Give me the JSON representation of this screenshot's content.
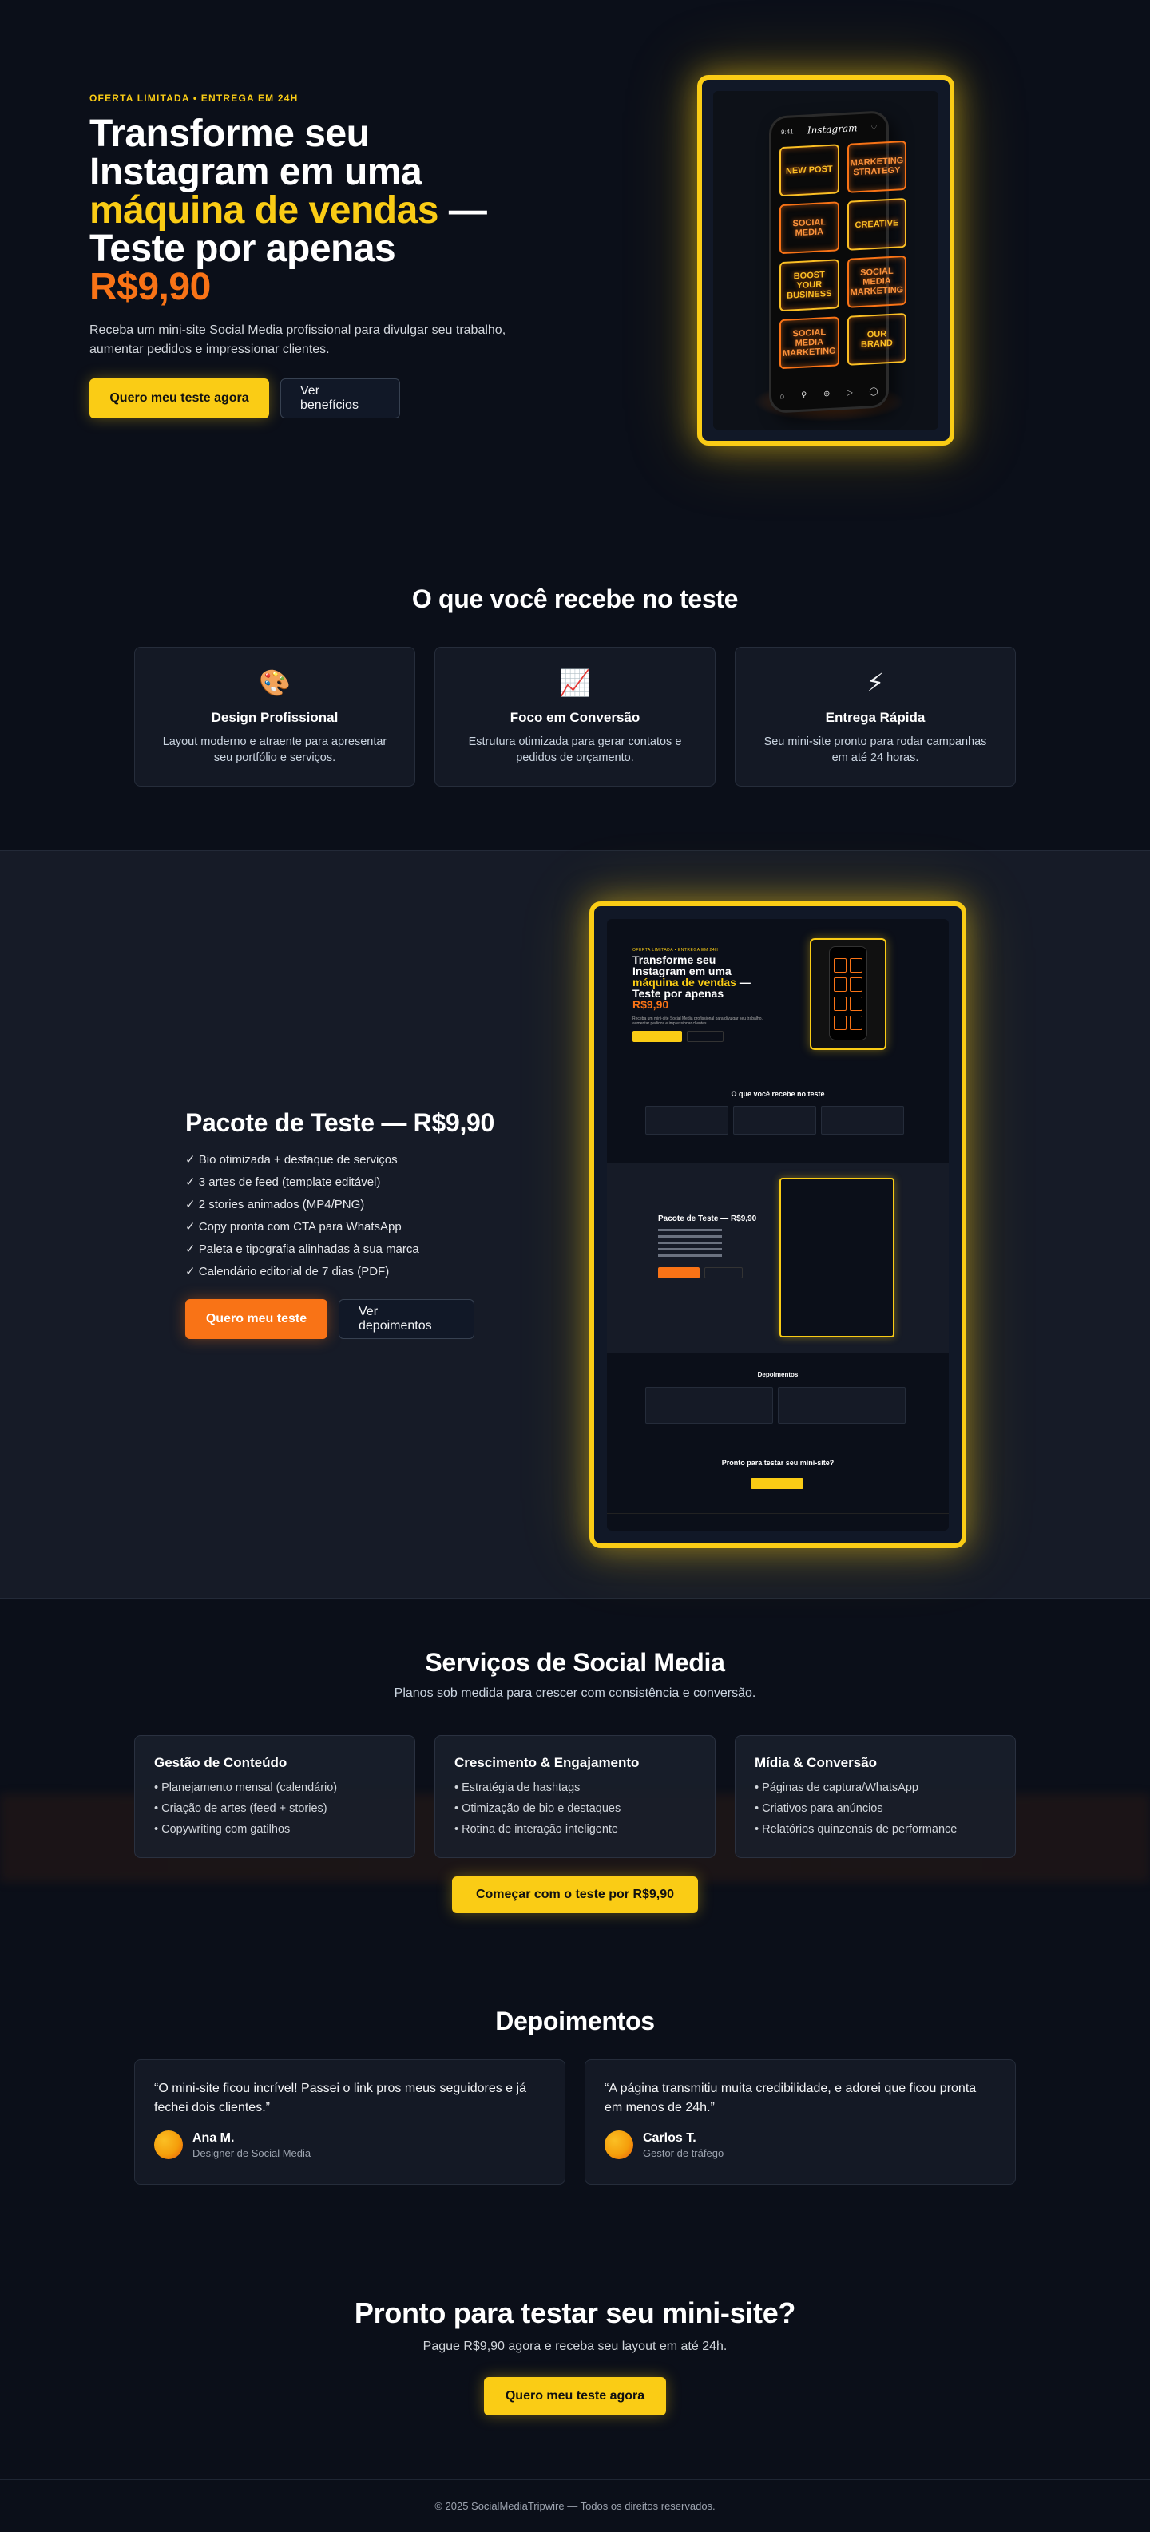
{
  "hero": {
    "eyebrow": "OFERTA LIMITADA • ENTREGA EM 24H",
    "title_line1": "Transforme seu",
    "title_line2": "Instagram em uma",
    "title_highlight": "máquina de vendas",
    "title_dash": " —",
    "title_line4": "Teste por apenas",
    "price": "R$9,90",
    "description": "Receba um mini-site Social Media profissional para divulgar seu trabalho, aumentar pedidos e impressionar clientes.",
    "primary_button": "Quero meu teste agora",
    "secondary_button": "Ver benefícios",
    "phone": {
      "brand": "Instagram",
      "time": "9:41",
      "tiles": [
        "NEW POST",
        "MARKETING STRATEGY",
        "SOCIAL MEDIA",
        "CREATIVE",
        "BOOST YOUR BUSINESS",
        "SOCIAL MEDIA MARKETING",
        "SOCIAL MEDIA MARKETING",
        "OUR BRAND"
      ]
    }
  },
  "receive": {
    "title": "O que você recebe no teste",
    "features": [
      {
        "icon": "🎨",
        "icon_name": "palette-icon",
        "title": "Design Profissional",
        "text": "Layout moderno e atraente para apresentar seu portfólio e serviços."
      },
      {
        "icon": "📈",
        "icon_name": "chart-up-icon",
        "title": "Foco em Conversão",
        "text": "Estrutura otimizada para gerar contatos e pedidos de orçamento."
      },
      {
        "icon": "⚡",
        "icon_name": "lightning-icon",
        "title": "Entrega Rápida",
        "text": "Seu mini-site pronto para rodar campanhas em até 24 horas."
      }
    ]
  },
  "package": {
    "title": "Pacote de Teste — R$9,90",
    "items": [
      "✓ Bio otimizada + destaque de serviços",
      "✓ 3 artes de feed (template editável)",
      "✓ 2 stories animados (MP4/PNG)",
      "✓ Copy pronta com CTA para WhatsApp",
      "✓ Paleta e tipografia alinhadas à sua marca",
      "✓ Calendário editorial de 7 dias (PDF)"
    ],
    "primary_button": "Quero meu teste",
    "secondary_button": "Ver depoimentos",
    "preview": {
      "hero_title_1": "Transforme seu Instagram em uma",
      "hero_title_highlight": "máquina de vendas",
      "hero_title_2": "— Teste por apenas",
      "hero_price": "R$9,90",
      "receive_title": "O que você recebe no teste",
      "package_title": "Pacote de Teste — R$9,90",
      "testimonials_title": "Depoimentos",
      "cta_title": "Pronto para testar seu mini-site?"
    }
  },
  "services": {
    "title": "Serviços de Social Media",
    "subtitle": "Planos sob medida para crescer com consistência e conversão.",
    "cards": [
      {
        "title": "Gestão de Conteúdo",
        "items": [
          "• Planejamento mensal (calendário)",
          "• Criação de artes (feed + stories)",
          "• Copywriting com gatilhos"
        ]
      },
      {
        "title": "Crescimento & Engajamento",
        "items": [
          "• Estratégia de hashtags",
          "• Otimização de bio e destaques",
          "• Rotina de interação inteligente"
        ]
      },
      {
        "title": "Mídia & Conversão",
        "items": [
          "• Páginas de captura/WhatsApp",
          "• Criativos para anúncios",
          "• Relatórios quinzenais de performance"
        ]
      }
    ],
    "button": "Começar com o teste por R$9,90"
  },
  "testimonials": {
    "title": "Depoimentos",
    "items": [
      {
        "quote": "“O mini-site ficou incrível! Passei o link pros meus seguidores e já fechei dois clientes.”",
        "name": "Ana M.",
        "role": "Designer de Social Media"
      },
      {
        "quote": "“A página transmitiu muita credibilidade, e adorei que ficou pronta em menos de 24h.”",
        "name": "Carlos T.",
        "role": "Gestor de tráfego"
      }
    ]
  },
  "cta": {
    "title": "Pronto para testar seu mini-site?",
    "subtitle": "Pague R$9,90 agora e receba seu layout em até 24h.",
    "button": "Quero meu teste agora"
  },
  "footer": {
    "text": "© 2025 SocialMediaTripwire — Todos os direitos reservados."
  },
  "colors": {
    "background": "#0b0f19",
    "accent_yellow": "#facc15",
    "accent_orange": "#f97316"
  }
}
